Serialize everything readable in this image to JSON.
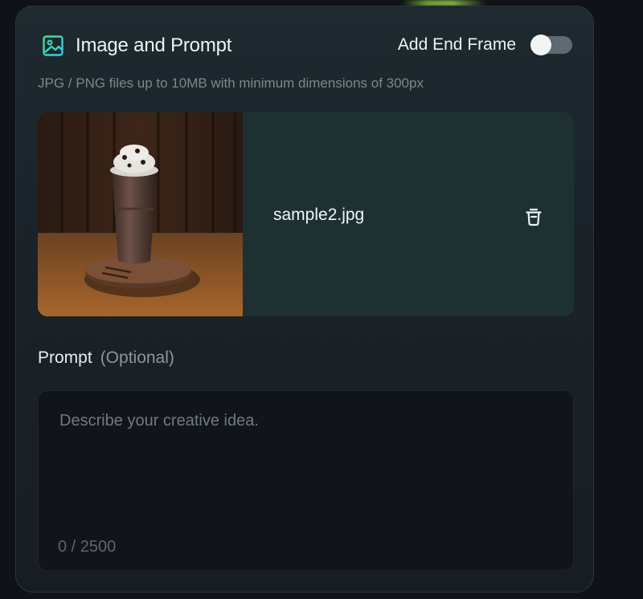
{
  "panel": {
    "title": "Image and Prompt",
    "end_frame_label": "Add End Frame",
    "end_frame_enabled": false,
    "hint": "JPG / PNG files up to 10MB with minimum dimensions of 300px"
  },
  "upload": {
    "file_name": "sample2.jpg"
  },
  "prompt": {
    "label": "Prompt",
    "optional": "(Optional)",
    "placeholder": "Describe your creative idea.",
    "value": "",
    "counter": "0 / 2500"
  },
  "icons": {
    "header": "image-icon",
    "delete": "trash-icon"
  },
  "colors": {
    "icon_gradient_start": "#3ee08a",
    "icon_gradient_end": "#3fc2f0",
    "card_bg": "#1d3133",
    "toggle_off": "#5e6a70"
  }
}
